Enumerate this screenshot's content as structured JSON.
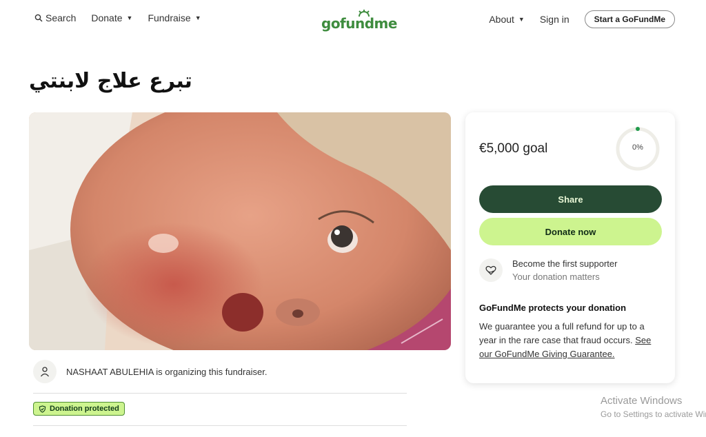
{
  "header": {
    "search_label": "Search",
    "donate_label": "Donate",
    "fundraise_label": "Fundraise",
    "logo_text": "gofundme",
    "about_label": "About",
    "signin_label": "Sign in",
    "start_label": "Start a GoFundMe"
  },
  "campaign": {
    "title": "تبرع علاج لابنتي",
    "organizer_text": "NASHAAT ABULEHIA is organizing this fundraiser.",
    "badge_label": "Donation protected"
  },
  "card": {
    "goal": "€5,000 goal",
    "progress_label": "0%",
    "progress_fraction": 0,
    "share_label": "Share",
    "donate_label": "Donate now",
    "supporter_main": "Become the first supporter",
    "supporter_sub": "Your donation matters",
    "protect_title": "GoFundMe protects your donation",
    "protect_text": "We guarantee you a full refund for up to a year in the rare case that fraud occurs.",
    "protect_link": "See our GoFundMe Giving Guarantee."
  },
  "watermark": {
    "line1": "Activate Windows",
    "line2": "Go to Settings to activate Windows."
  },
  "colors": {
    "brand_green": "#3e8c3e",
    "share_bg": "#274b34",
    "donate_bg": "#cdf48f"
  }
}
